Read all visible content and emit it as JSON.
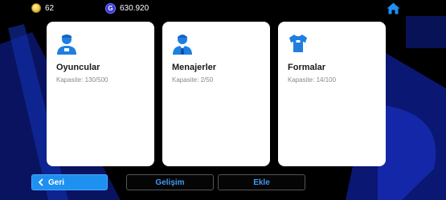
{
  "topbar": {
    "coins": {
      "icon": "coin-icon",
      "value": "62"
    },
    "gp": {
      "icon": "gp-icon",
      "symbol": "G",
      "value": "630.920"
    },
    "home": {
      "icon": "home-icon"
    }
  },
  "cards": [
    {
      "icon": "player-icon",
      "title": "Oyuncular",
      "capacity": "Kapasite: 130/500"
    },
    {
      "icon": "manager-icon",
      "title": "Menajerler",
      "capacity": "Kapasite: 2/50"
    },
    {
      "icon": "jersey-icon",
      "title": "Formalar",
      "capacity": "Kapasite: 14/100"
    }
  ],
  "buttons": {
    "back": {
      "label": "Geri",
      "icon": "chevron-left-icon"
    },
    "gelisim": "Gelişim",
    "ekle": "Ekle"
  },
  "colors": {
    "accent": "#1e90f0",
    "icon_blue": "#1e7fe0",
    "background": "#000000",
    "deco_blue": "#0d1f8a"
  }
}
